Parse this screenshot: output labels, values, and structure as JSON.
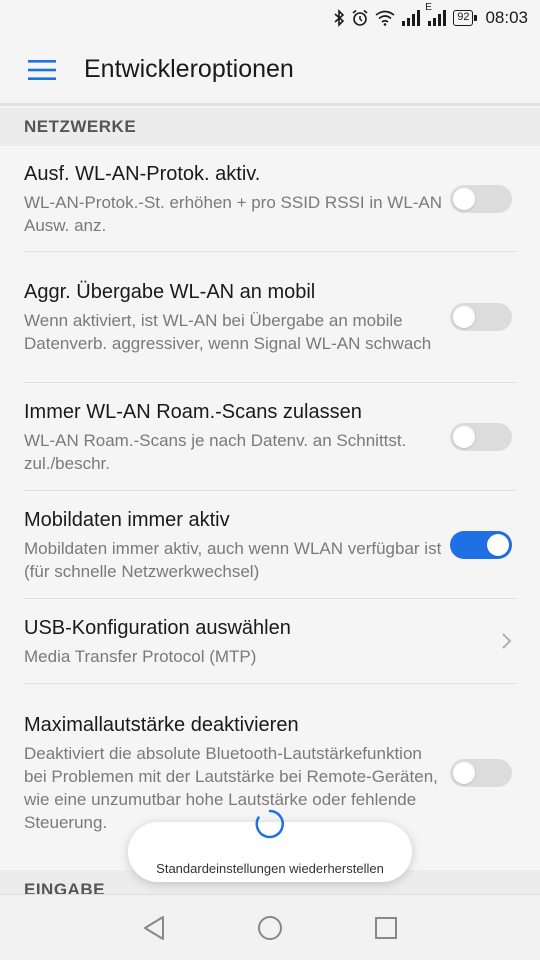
{
  "status_bar": {
    "icons": [
      "bluetooth-icon",
      "alarm-icon",
      "wifi-icon",
      "signal-icon",
      "signal-e-icon",
      "battery-icon"
    ],
    "network_label": "E",
    "battery_level": "92",
    "time": "08:03"
  },
  "header": {
    "title": "Entwickleroptionen"
  },
  "sections": {
    "network": {
      "title": "NETZWERKE"
    },
    "input": {
      "title": "EINGABE"
    }
  },
  "settings": [
    {
      "title": "Ausf. WL-AN-Protok. aktiv.",
      "subtitle": "WL-AN-Protok.-St. erhöhen + pro SSID RSSI in WL-AN Ausw. anz.",
      "control": "toggle",
      "enabled": false
    },
    {
      "title": "Aggr. Übergabe WL-AN an mobil",
      "subtitle": "Wenn aktiviert, ist WL-AN bei Übergabe an mobile Datenverb. aggressiver, wenn Signal WL-AN schwach",
      "control": "toggle",
      "enabled": false
    },
    {
      "title": "Immer WL-AN Roam.-Scans zulassen",
      "subtitle": "WL-AN Roam.-Scans je nach Datenv. an Schnittst. zul./beschr.",
      "control": "toggle",
      "enabled": false
    },
    {
      "title": "Mobildaten immer aktiv",
      "subtitle": "Mobildaten immer aktiv, auch wenn WLAN verfügbar ist (für schnelle Netzwerkwechsel)",
      "control": "toggle",
      "enabled": true
    },
    {
      "title": "USB-Konfiguration auswählen",
      "subtitle": "Media Transfer Protocol (MTP)",
      "control": "chevron"
    },
    {
      "title": "Maximallautstärke deaktivieren",
      "subtitle": "Deaktiviert die absolute Bluetooth-Lautstärkefunktion bei Problemen mit der Lautstärke bei Remote-Geräten, wie eine unzumutbar hohe Lautstärke oder fehlende Steuerung.",
      "control": "toggle",
      "enabled": false
    }
  ],
  "toast": {
    "text": "Standardeinstellungen wiederherstellen"
  },
  "colors": {
    "accent": "#1f6fe5",
    "toggle_off": "#dcdcdc",
    "background": "#f5f5f5"
  }
}
